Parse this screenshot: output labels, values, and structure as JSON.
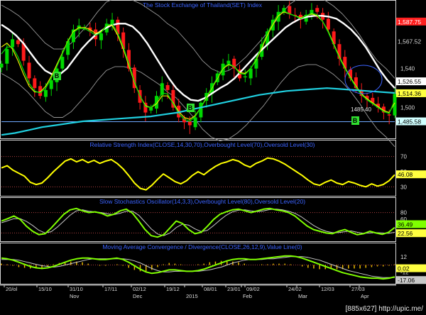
{
  "watermark": "[885x627] http://upic.me/",
  "colors": {
    "background": "#000000",
    "up_candle": "#00d800",
    "down_candle": "#ff1a1a",
    "ma_white": "#ffffff",
    "ma_yellow": "#e8e800",
    "ma_green": "#00e000",
    "ma_cyan": "#20d0e0",
    "rsi_line": "#ffff00",
    "stoch_fast": "#7fff00",
    "stoch_slow": "#c8c8c8",
    "macd_line": "#7fff00",
    "signal_line": "#c8c8c8",
    "histogram": "#e8b800",
    "level_line": "#b04040",
    "pane_title": "#3b63ff",
    "price_label_red": "#ff2020",
    "price_label_yellow": "#ffff40",
    "price_label_white": "#ffffff",
    "price_label_cyan": "#d0ffff"
  },
  "chart_data": [
    {
      "pane": "price",
      "type": "candlestick",
      "title": "The Stock Exchange of Thailand(SET) Index",
      "ylim": [
        1470,
        1600
      ],
      "y_ticks": [
        "1,567.52",
        "1,540",
        "1,526.55",
        "1,500",
        "1,485.58"
      ],
      "price_tags": [
        {
          "text": "1,587.75",
          "value": 1587.75,
          "style": "red"
        },
        {
          "text": "1,567.52",
          "value": 1567.52,
          "style": "plain"
        },
        {
          "text": "1,526.55",
          "value": 1526.55,
          "style": "white"
        },
        {
          "text": "1,514.36",
          "value": 1514.36,
          "style": "yellow"
        },
        {
          "text": "1,485.58",
          "value": 1485.58,
          "style": "cyan"
        }
      ],
      "low_annotation": "1485.40",
      "buy_markers": [
        "B",
        "B",
        "B"
      ],
      "closes": [
        1545,
        1560,
        1570,
        1565,
        1548,
        1530,
        1520,
        1512,
        1518,
        1528,
        1540,
        1552,
        1568,
        1580,
        1584,
        1582,
        1578,
        1570,
        1576,
        1586,
        1590,
        1575,
        1560,
        1540,
        1520,
        1505,
        1495,
        1500,
        1512,
        1525,
        1518,
        1500,
        1490,
        1485,
        1482,
        1490,
        1505,
        1515,
        1525,
        1535,
        1545,
        1548,
        1540,
        1530,
        1532,
        1540,
        1550,
        1565,
        1578,
        1590,
        1598,
        1602,
        1596,
        1594,
        1590,
        1595,
        1600,
        1598,
        1590,
        1580,
        1565,
        1550,
        1540,
        1530,
        1520,
        1512,
        1508,
        1505,
        1500,
        1495,
        1492,
        1514
      ],
      "ma_lines": [
        {
          "color_key": "ma_white",
          "values": [
            1585,
            1580,
            1574,
            1566,
            1556,
            1546,
            1538,
            1534,
            1534,
            1540,
            1550,
            1560,
            1568,
            1575,
            1580,
            1584,
            1586,
            1586,
            1583,
            1576,
            1566,
            1554,
            1542,
            1530,
            1520,
            1513,
            1508,
            1507,
            1510,
            1515,
            1520,
            1524,
            1530,
            1538,
            1546,
            1554,
            1561,
            1568,
            1575,
            1582,
            1587,
            1591,
            1593,
            1594,
            1594,
            1593,
            1591,
            1586,
            1580,
            1572,
            1562,
            1550,
            1538,
            1528,
            1520
          ]
        },
        {
          "color_key": "ma_yellow",
          "values": [
            1562,
            1566,
            1560,
            1548,
            1534,
            1522,
            1516,
            1516,
            1522,
            1532,
            1544,
            1556,
            1568,
            1578,
            1582,
            1582,
            1580,
            1576,
            1578,
            1584,
            1584,
            1574,
            1560,
            1543,
            1526,
            1512,
            1502,
            1500,
            1504,
            1512,
            1512,
            1505,
            1496,
            1490,
            1488,
            1492,
            1500,
            1510,
            1520,
            1530,
            1540,
            1544,
            1542,
            1536,
            1535,
            1540,
            1549,
            1561,
            1574,
            1585,
            1594,
            1598,
            1596,
            1594,
            1592,
            1594,
            1596,
            1594,
            1588,
            1578,
            1565,
            1552,
            1541,
            1531,
            1522,
            1514,
            1509,
            1505,
            1501,
            1497,
            1495,
            1505
          ]
        },
        {
          "color_key": "ma_green",
          "values": [
            1555,
            1562,
            1562,
            1552,
            1538,
            1525,
            1517,
            1515,
            1520,
            1530,
            1542,
            1555,
            1567,
            1577,
            1581,
            1581,
            1578,
            1574,
            1577,
            1584,
            1586,
            1576,
            1562,
            1545,
            1527,
            1512,
            1501,
            1500,
            1506,
            1515,
            1514,
            1504,
            1494,
            1488,
            1486,
            1491,
            1500,
            1511,
            1521,
            1531,
            1541,
            1545,
            1542,
            1535,
            1534,
            1540,
            1550,
            1563,
            1576,
            1587,
            1596,
            1599,
            1596,
            1594,
            1591,
            1594,
            1597,
            1595,
            1588,
            1577,
            1564,
            1551,
            1540,
            1530,
            1521,
            1513,
            1508,
            1504,
            1500,
            1496,
            1494,
            1508
          ]
        },
        {
          "color_key": "ma_cyan",
          "values": [
            1472,
            1474,
            1477,
            1480,
            1482,
            1484,
            1486,
            1487,
            1488,
            1489,
            1490,
            1491,
            1493,
            1495,
            1498,
            1501,
            1504,
            1507,
            1510,
            1513,
            1515,
            1517,
            1518,
            1519,
            1520,
            1519,
            1518,
            1517,
            1516,
            1515
          ]
        }
      ],
      "envelope_upper": [
        1605,
        1600,
        1594,
        1586,
        1576,
        1566,
        1560,
        1560,
        1566,
        1576,
        1586,
        1598,
        1608,
        1612,
        1612,
        1610,
        1606,
        1600,
        1594,
        1586,
        1580,
        1570,
        1560,
        1548,
        1540,
        1536,
        1538,
        1544,
        1552,
        1562,
        1572,
        1584,
        1596,
        1606,
        1612,
        1614,
        1614,
        1610,
        1604,
        1596,
        1586,
        1574,
        1560,
        1548,
        1540,
        1530
      ]
    },
    {
      "pane": "rsi",
      "type": "line",
      "title": "Relative Strength Index(CLOSE,14,30,70),Overbought Level(70),Oversold Level(30)",
      "ylim": [
        20,
        80
      ],
      "y_ticks": [
        "70",
        "50",
        "40",
        "30"
      ],
      "levels": [
        70,
        30
      ],
      "last_value_label": "46.08",
      "last_value": 46.08,
      "series": [
        {
          "values": [
            55,
            58,
            52,
            48,
            44,
            36,
            33,
            35,
            42,
            50,
            57,
            64,
            67,
            63,
            66,
            62,
            65,
            61,
            64,
            66,
            61,
            54,
            45,
            35,
            28,
            26,
            32,
            40,
            47,
            42,
            37,
            34,
            38,
            45,
            50,
            46,
            52,
            57,
            61,
            63,
            66,
            64,
            59,
            56,
            61,
            64,
            68,
            67,
            64,
            60,
            55,
            50,
            45,
            39,
            34,
            32,
            36,
            39,
            35,
            33,
            37,
            35,
            32,
            30,
            34,
            31,
            33,
            38,
            46
          ]
        }
      ]
    },
    {
      "pane": "stochastic",
      "type": "line",
      "title": "Slow Stochastics Oscillator(14,3,3),Overbought Level(80),Oversold Level(20)",
      "ylim": [
        0,
        100
      ],
      "y_ticks": [
        "80",
        "60",
        "40",
        "22.56"
      ],
      "levels": [
        80,
        20
      ],
      "last_value_labels": [
        "36.49",
        "22.56"
      ],
      "series": [
        {
          "name": "%K",
          "values": [
            55,
            62,
            70,
            60,
            40,
            25,
            15,
            18,
            35,
            55,
            75,
            88,
            92,
            85,
            80,
            82,
            78,
            70,
            75,
            85,
            90,
            78,
            55,
            30,
            12,
            8,
            15,
            35,
            55,
            48,
            30,
            18,
            22,
            40,
            60,
            75,
            82,
            88,
            90,
            85,
            80,
            85,
            90,
            92,
            88,
            85,
            80,
            70,
            55,
            40,
            30,
            25,
            20,
            18,
            25,
            30,
            22,
            15,
            18,
            25,
            20,
            16,
            22,
            36
          ]
        },
        {
          "name": "%D",
          "values": [
            50,
            56,
            62,
            62,
            54,
            42,
            28,
            20,
            24,
            38,
            55,
            72,
            85,
            88,
            84,
            82,
            80,
            76,
            74,
            78,
            84,
            84,
            72,
            52,
            32,
            17,
            12,
            20,
            36,
            46,
            43,
            32,
            24,
            28,
            42,
            58,
            72,
            82,
            87,
            88,
            85,
            83,
            85,
            89,
            90,
            88,
            84,
            78,
            68,
            55,
            42,
            32,
            25,
            21,
            21,
            24,
            26,
            22,
            19,
            20,
            21,
            20,
            19,
            22
          ]
        }
      ]
    },
    {
      "pane": "macd",
      "type": "line",
      "title": "Moving Average Convergence / Divergence(CLOSE,26,12,9),Value Line(0)",
      "ylim": [
        -25,
        20
      ],
      "y_ticks": [
        "12",
        "0",
        "-12",
        "-17.06"
      ],
      "levels": [
        0
      ],
      "last_value_labels": [
        "0.02",
        "-17.06"
      ],
      "series": [
        {
          "name": "MACD",
          "values": [
            10,
            9,
            7,
            4,
            1,
            -2,
            -4,
            -5,
            -4,
            -2,
            1,
            4,
            7,
            9,
            10,
            10,
            9,
            8,
            8,
            9,
            10,
            8,
            4,
            -1,
            -6,
            -10,
            -12,
            -11,
            -9,
            -7,
            -7,
            -8,
            -9,
            -9,
            -8,
            -6,
            -3,
            0,
            3,
            6,
            8,
            9,
            9,
            8,
            8,
            9,
            10,
            11,
            12,
            13,
            13,
            12,
            10,
            7,
            4,
            1,
            -2,
            -5,
            -8,
            -11,
            -13,
            -15,
            -17,
            -18,
            -19,
            -19,
            -20,
            -19,
            -17
          ]
        },
        {
          "name": "Signal",
          "values": [
            8,
            8,
            8,
            7,
            5,
            3,
            1,
            -1,
            -2,
            -3,
            -2,
            0,
            2,
            4,
            6,
            8,
            9,
            9,
            9,
            9,
            9,
            9,
            8,
            6,
            3,
            -1,
            -5,
            -8,
            -10,
            -10,
            -9,
            -9,
            -9,
            -9,
            -9,
            -8,
            -7,
            -5,
            -3,
            0,
            3,
            5,
            7,
            8,
            8,
            8,
            9,
            9,
            10,
            11,
            12,
            12,
            12,
            11,
            9,
            7,
            4,
            1,
            -2,
            -5,
            -8,
            -10,
            -12,
            -14,
            -16,
            -17,
            -18,
            -18,
            -18
          ]
        },
        {
          "name": "Histogram",
          "values": [
            2,
            1,
            -1,
            -3,
            -4,
            -5,
            -5,
            -4,
            -2,
            1,
            3,
            4,
            5,
            5,
            4,
            2,
            0,
            -1,
            -1,
            0,
            1,
            -1,
            -4,
            -7,
            -9,
            -9,
            -7,
            -3,
            1,
            3,
            2,
            1,
            0,
            0,
            1,
            2,
            4,
            5,
            6,
            6,
            5,
            4,
            2,
            0,
            0,
            1,
            1,
            2,
            2,
            2,
            1,
            0,
            -2,
            -4,
            -5,
            -6,
            -6,
            -6,
            -6,
            -6,
            -5,
            -5,
            -5,
            -4,
            -3,
            -2,
            -2,
            -1,
            1
          ]
        }
      ]
    }
  ],
  "x_axis": {
    "labels": [
      "20/ol",
      "15/10",
      "Nov",
      "31/10",
      "17/11",
      "Dec",
      "02/12",
      "19/12",
      "2015",
      "08/01",
      "23/01",
      "Feb",
      "09/02",
      "24/02",
      "Mar",
      "12/03",
      "27/03",
      "Apr"
    ]
  }
}
